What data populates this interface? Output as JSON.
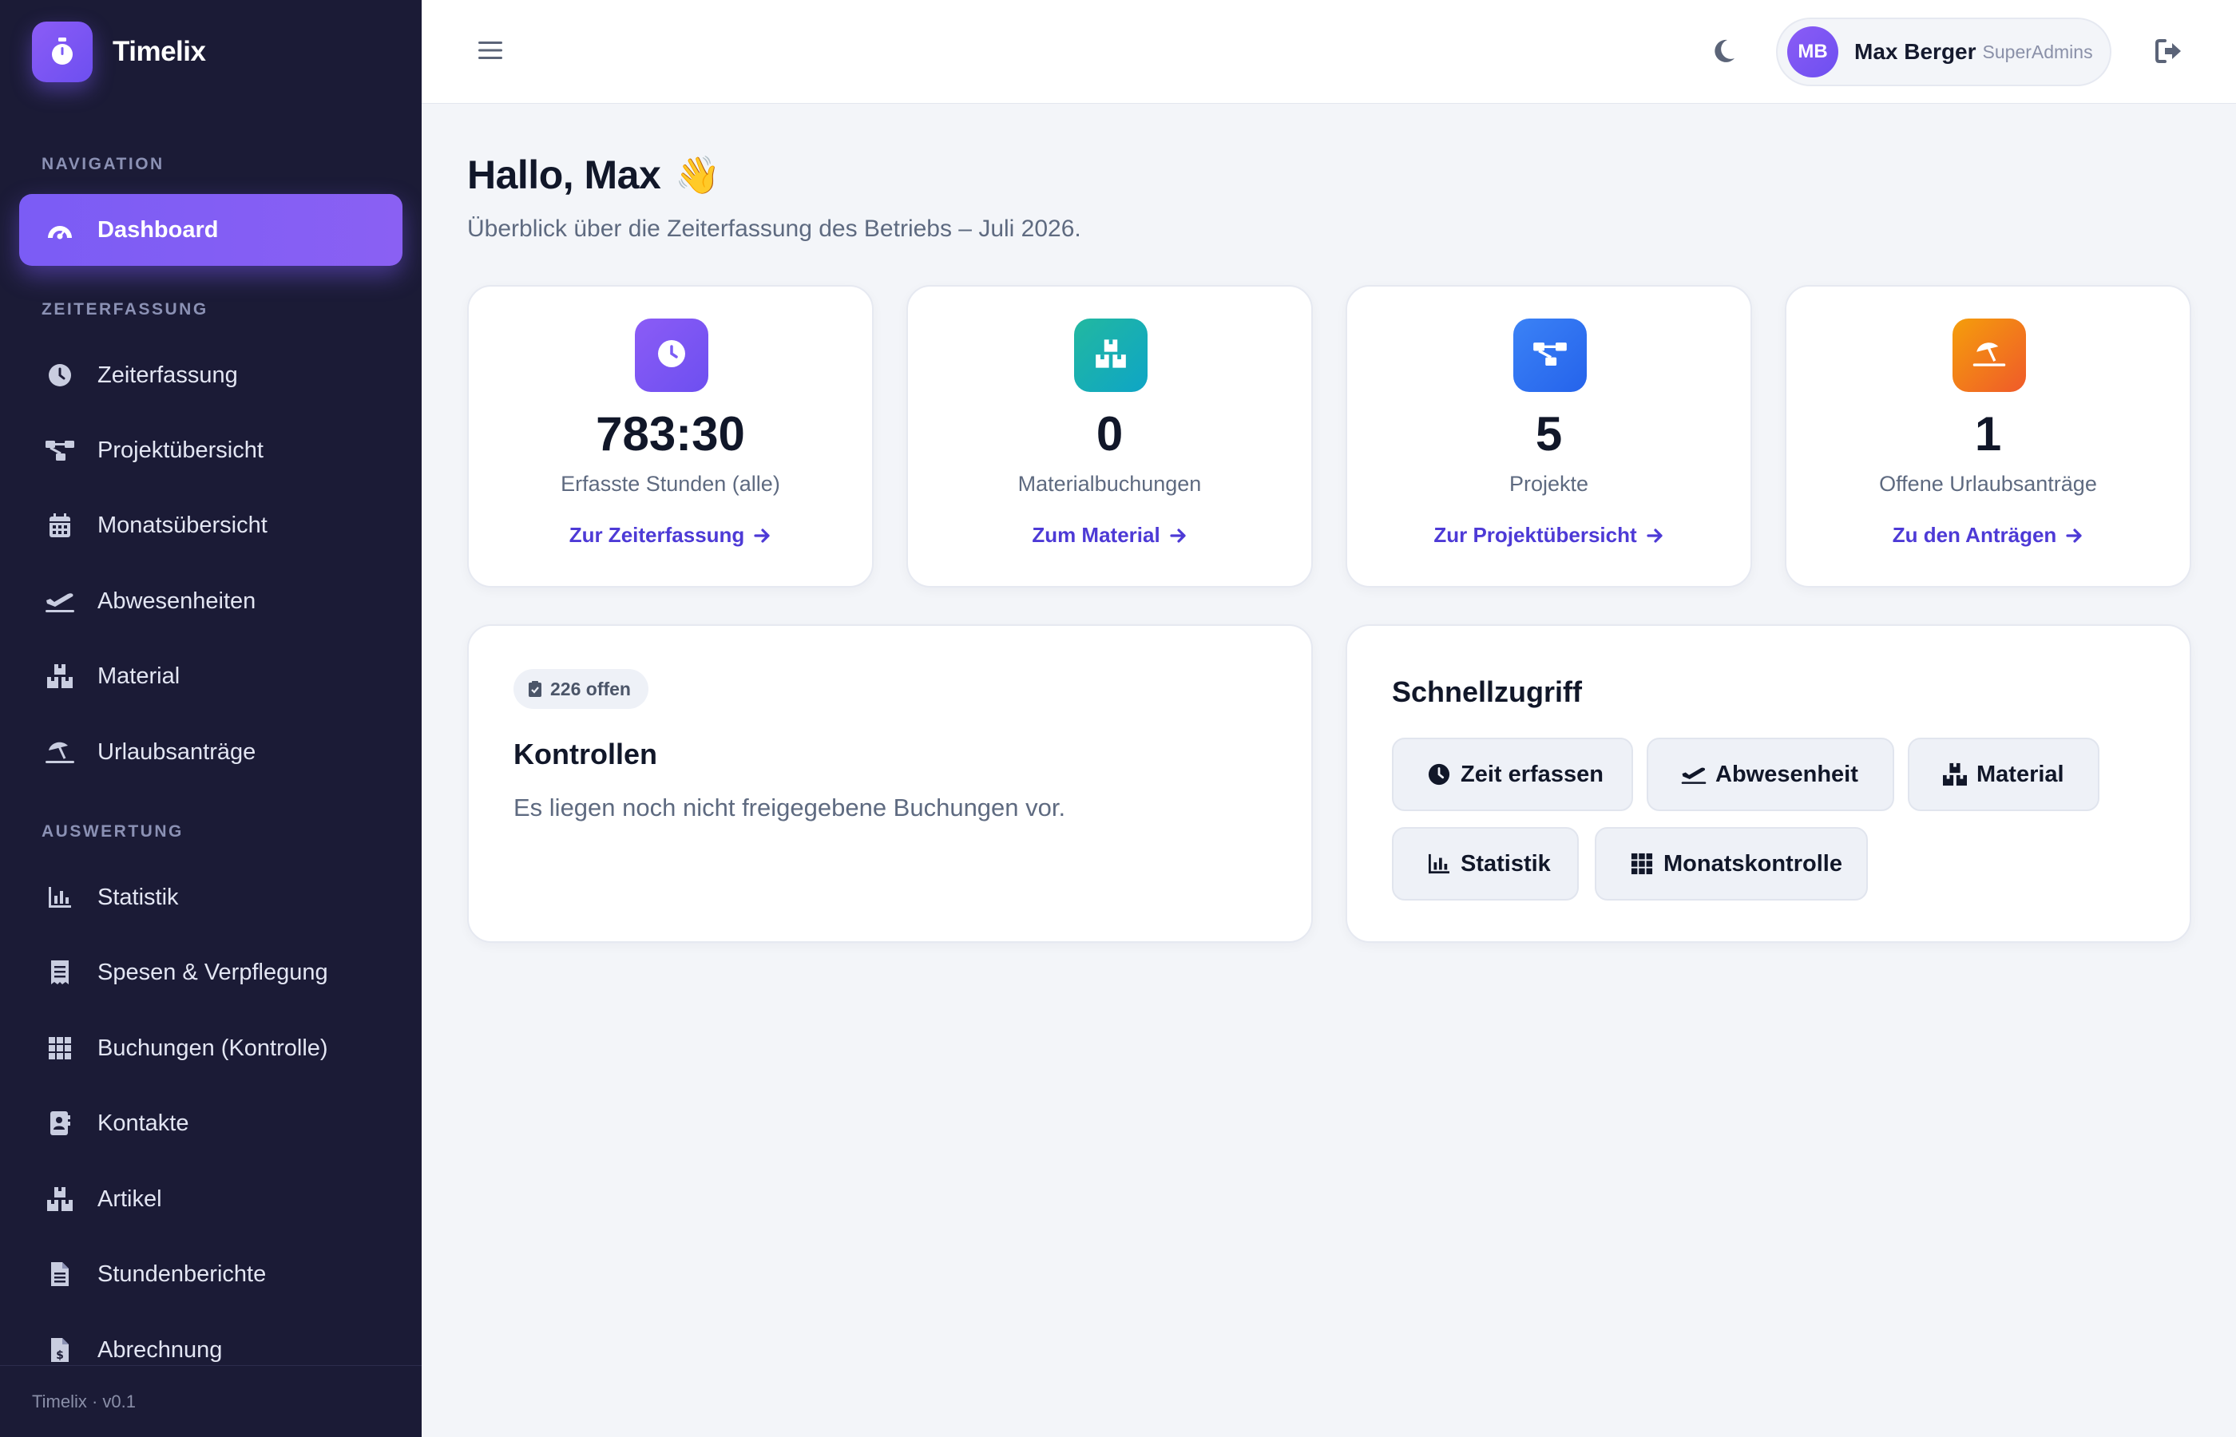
{
  "app": {
    "name": "Timelix",
    "version": "Timelix · v0.1"
  },
  "sidebar": {
    "sections": {
      "navigation": "NAVIGATION",
      "zeiterfassung": "ZEITERFASSUNG",
      "auswertung": "AUSWERTUNG"
    },
    "items": [
      {
        "label": "Dashboard",
        "icon": "gauge-icon",
        "active": true
      },
      {
        "label": "Zeiterfassung",
        "icon": "clock-icon"
      },
      {
        "label": "Projektübersicht",
        "icon": "sitemap-icon"
      },
      {
        "label": "Monatsübersicht",
        "icon": "calendar-icon"
      },
      {
        "label": "Abwesenheiten",
        "icon": "plane-departure-icon"
      },
      {
        "label": "Material",
        "icon": "boxes-icon"
      },
      {
        "label": "Urlaubsanträge",
        "icon": "umbrella-beach-icon"
      },
      {
        "label": "Statistik",
        "icon": "bar-chart-icon"
      },
      {
        "label": "Spesen & Verpflegung",
        "icon": "receipt-icon"
      },
      {
        "label": "Buchungen (Kontrolle)",
        "icon": "grid-icon"
      },
      {
        "label": "Kontakte",
        "icon": "address-book-icon"
      },
      {
        "label": "Artikel",
        "icon": "boxes-icon"
      },
      {
        "label": "Stundenberichte",
        "icon": "file-lines-icon"
      },
      {
        "label": "Abrechnung",
        "icon": "file-invoice-dollar-icon"
      }
    ]
  },
  "topbar": {
    "user": {
      "initials": "MB",
      "name": "Max Berger",
      "role": "SuperAdmins"
    }
  },
  "main": {
    "greeting": "Hallo, Max",
    "greeting_emoji": "👋",
    "subtitle": "Überblick über die Zeiterfassung des Betriebs – Juli 2026.",
    "stats": [
      {
        "value": "783:30",
        "label": "Erfasste Stunden (alle)",
        "link": "Zur Zeiterfassung",
        "icon": "clock-icon",
        "color_from": "#8b5cf6",
        "color_to": "#6d4ff0"
      },
      {
        "value": "0",
        "label": "Materialbuchungen",
        "link": "Zum Material",
        "icon": "boxes-icon",
        "color_from": "#22b8a0",
        "color_to": "#0ea5c6"
      },
      {
        "value": "5",
        "label": "Projekte",
        "link": "Zur Projektübersicht",
        "icon": "sitemap-icon",
        "color_from": "#3b82f6",
        "color_to": "#2563eb"
      },
      {
        "value": "1",
        "label": "Offene Urlaubsanträge",
        "link": "Zu den Anträgen",
        "icon": "umbrella-beach-icon",
        "color_from": "#f59e0b",
        "color_to": "#ef5a2a"
      }
    ],
    "kontrollen": {
      "badge": "226 offen",
      "title": "Kontrollen",
      "text": "Es liegen noch nicht freigegebene Buchungen vor."
    },
    "schnellzugriff": {
      "title": "Schnellzugriff",
      "buttons": [
        {
          "label": "Zeit erfassen",
          "icon": "clock-icon"
        },
        {
          "label": "Abwesenheit",
          "icon": "plane-departure-icon"
        },
        {
          "label": "Material",
          "icon": "boxes-icon"
        },
        {
          "label": "Statistik",
          "icon": "bar-chart-icon"
        },
        {
          "label": "Monatskontrolle",
          "icon": "grid-icon"
        }
      ]
    }
  },
  "colors": {
    "sidebar_bg": "#1b1b36",
    "accent": "#7b5cf5",
    "link": "#4d3ad6",
    "page_bg": "#f3f5f9"
  }
}
